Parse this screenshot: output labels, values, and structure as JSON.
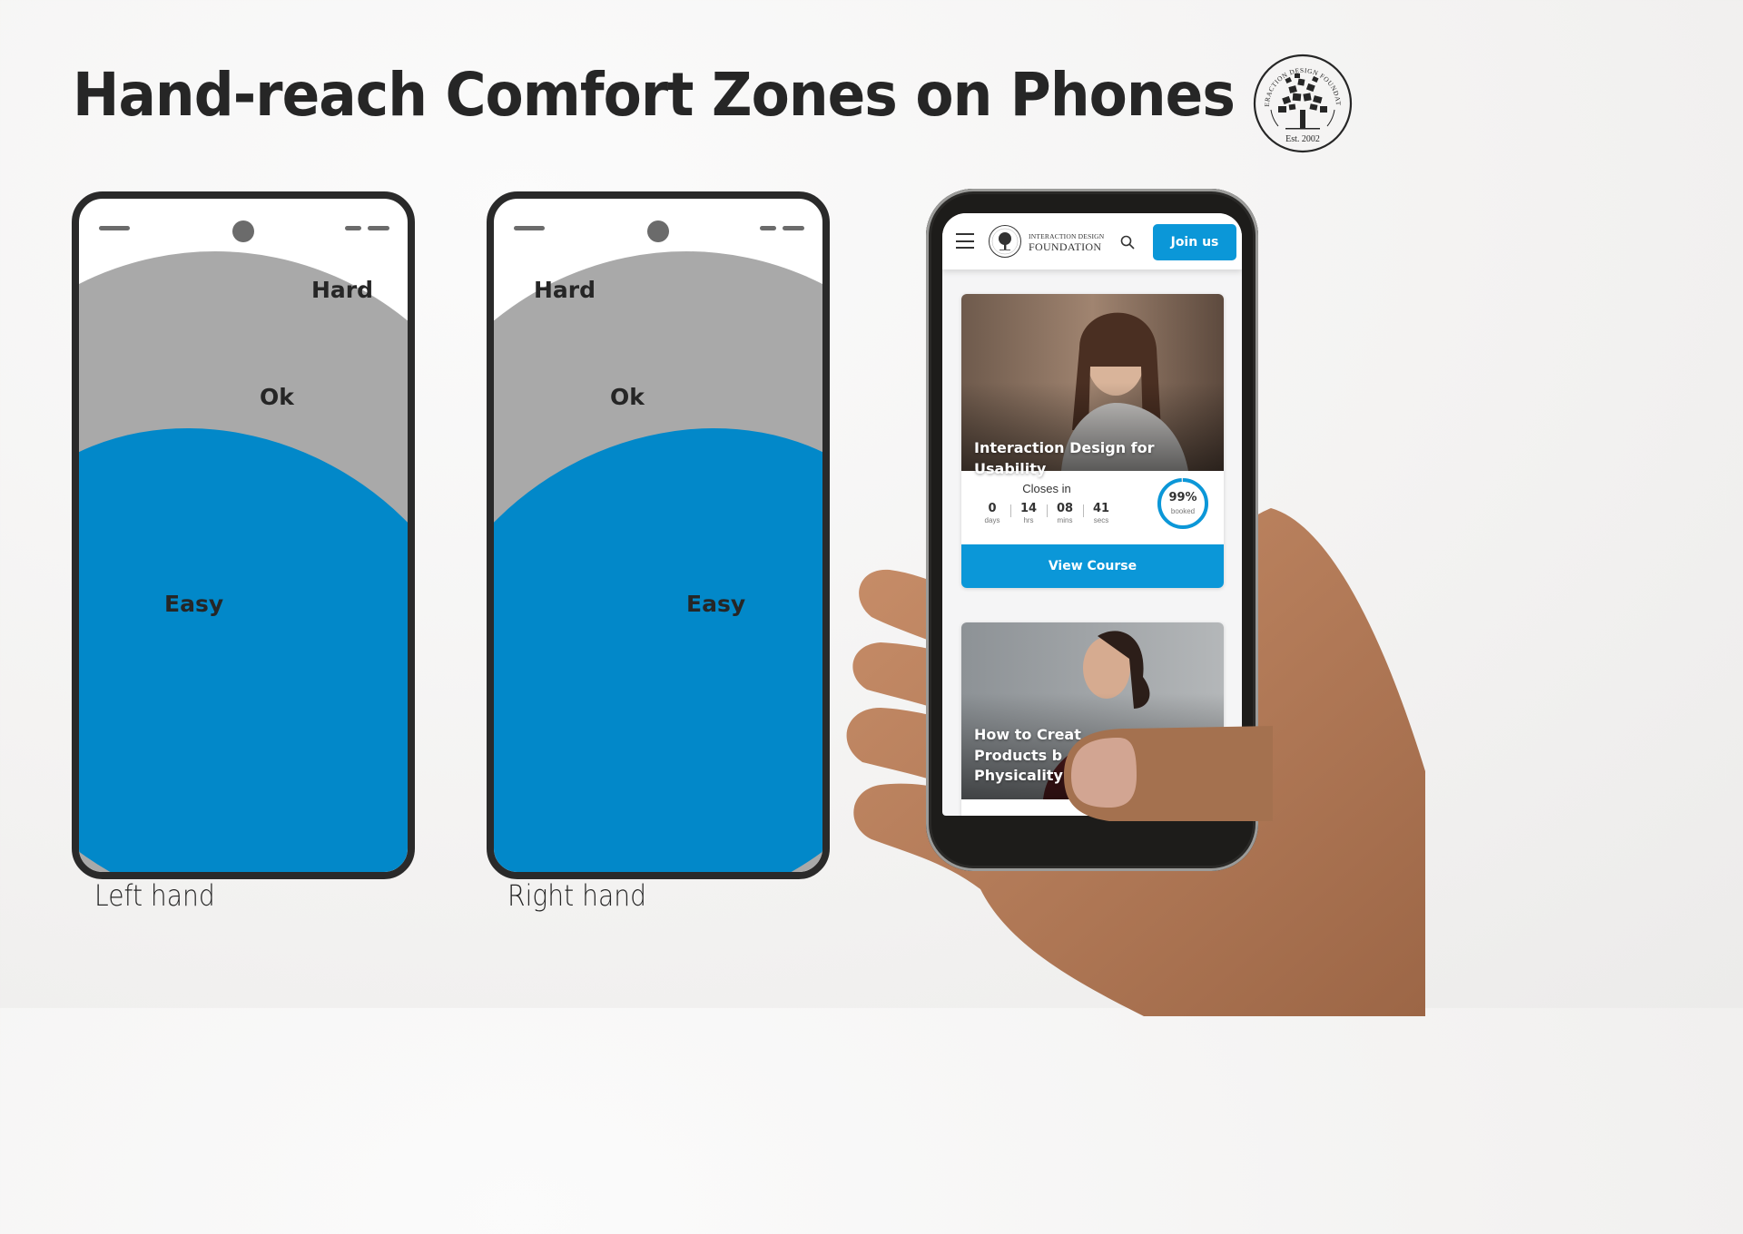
{
  "title": "Hand-reach Comfort Zones on Phones",
  "logo": {
    "ring_text": "INTERACTION DESIGN FOUNDATION",
    "established": "Est. 2002"
  },
  "zone_colors": {
    "easy": "#0288c9",
    "ok": "#a9a9a9",
    "hard": "#ffffff",
    "frame": "#2a2a2a"
  },
  "diagrams": [
    {
      "hand": "Left hand",
      "zones": {
        "hard": "Hard",
        "ok": "Ok",
        "easy": "Easy"
      }
    },
    {
      "hand": "Right hand",
      "zones": {
        "hard": "Hard",
        "ok": "Ok",
        "easy": "Easy"
      }
    }
  ],
  "app": {
    "brand_line1": "INTERACTION DESIGN",
    "brand_line2": "FOUNDATION",
    "menu_icon": "hamburger-icon",
    "search_icon": "search-icon",
    "join_label": "Join us",
    "accent_color": "#0b97d8",
    "courses": [
      {
        "title": "Interaction Design for Usability",
        "closes_label": "Closes in",
        "countdown": [
          {
            "value": "0",
            "unit": "days"
          },
          {
            "value": "14",
            "unit": "hrs"
          },
          {
            "value": "08",
            "unit": "mins"
          },
          {
            "value": "41",
            "unit": "secs"
          }
        ],
        "booked_percent": 99,
        "booked_label": "99%",
        "booked_sub": "booked",
        "cta": "View Course"
      },
      {
        "title_lines": [
          "How to Creat",
          "Products b",
          "Physicality"
        ]
      }
    ]
  }
}
